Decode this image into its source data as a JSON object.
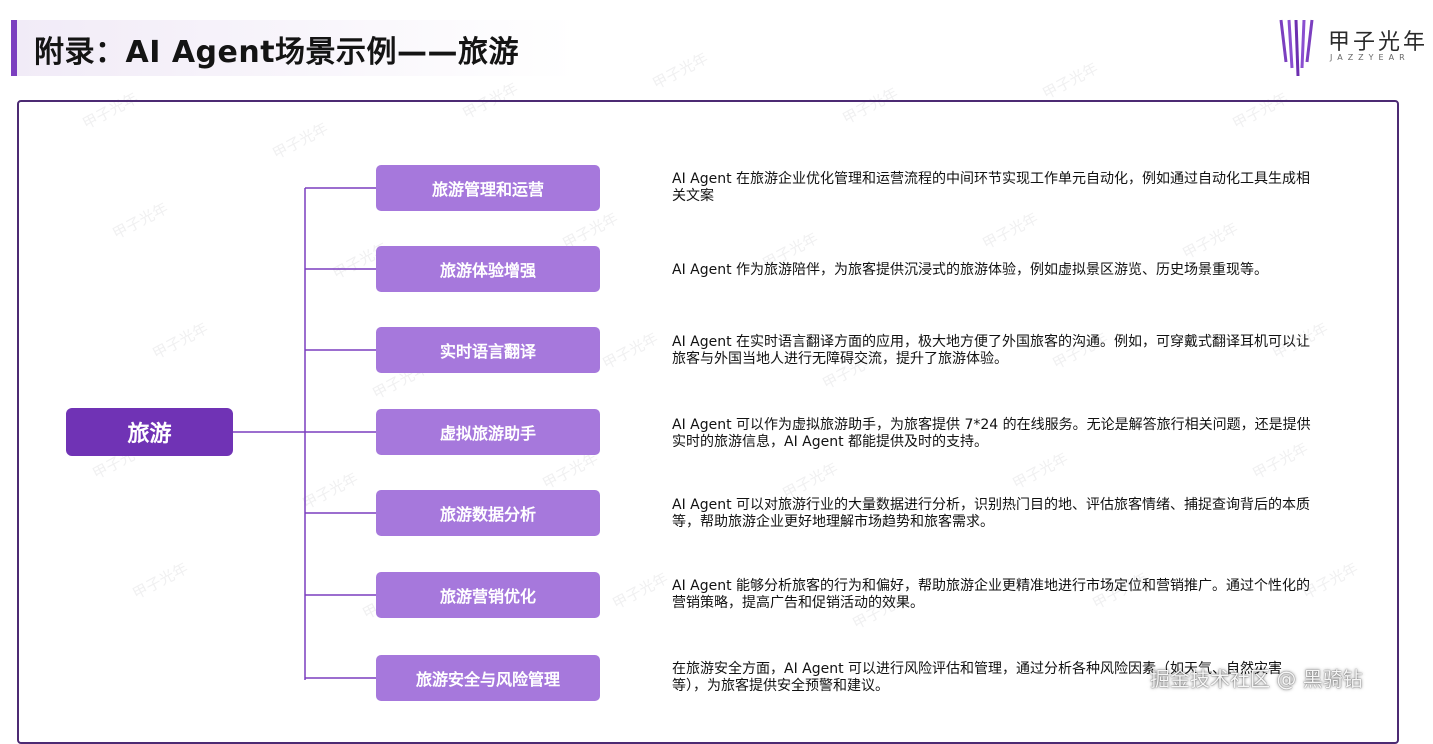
{
  "header": {
    "title": "附录：AI Agent场景示例——旅游"
  },
  "logo": {
    "name": "甲子光年",
    "subtitle": "JAZZYEAR"
  },
  "watermark_text": "甲子光年",
  "diagram": {
    "root": "旅游",
    "branches": [
      {
        "label": "旅游管理和运营",
        "description": "AI Agent 在旅游企业优化管理和运营流程的中间环节实现工作单元自动化，例如通过自动化工具生成相关文案"
      },
      {
        "label": "旅游体验增强",
        "description": "AI Agent 作为旅游陪伴，为旅客提供沉浸式的旅游体验，例如虚拟景区游览、历史场景重现等。"
      },
      {
        "label": "实时语言翻译",
        "description": "AI Agent 在实时语言翻译方面的应用，极大地方便了外国旅客的沟通。例如，可穿戴式翻译耳机可以让旅客与外国当地人进行无障碍交流，提升了旅游体验。"
      },
      {
        "label": "虚拟旅游助手",
        "description": "AI Agent 可以作为虚拟旅游助手，为旅客提供 7*24 的在线服务。无论是解答旅行相关问题，还是提供实时的旅游信息，AI Agent 都能提供及时的支持。"
      },
      {
        "label": "旅游数据分析",
        "description": "AI Agent 可以对旅游行业的大量数据进行分析，识别热门目的地、评估旅客情绪、捕捉查询背后的本质等，帮助旅游企业更好地理解市场趋势和旅客需求。"
      },
      {
        "label": "旅游营销优化",
        "description": "AI Agent 能够分析旅客的行为和偏好，帮助旅游企业更精准地进行市场定位和营销推广。通过个性化的营销策略，提高广告和促销活动的效果。"
      },
      {
        "label": "旅游安全与风险管理",
        "description": "在旅游安全方面，AI Agent 可以进行风险评估和管理，通过分析各种风险因素（如天气、自然灾害等），为旅客提供安全预警和建议。"
      }
    ]
  },
  "footer": {
    "credit": "掘金技术社区 @ 黑骑钻"
  },
  "colors": {
    "root": "#7033b5",
    "branch": "#a678dc",
    "accent": "#7b3fbf",
    "border": "#4c2a73"
  }
}
